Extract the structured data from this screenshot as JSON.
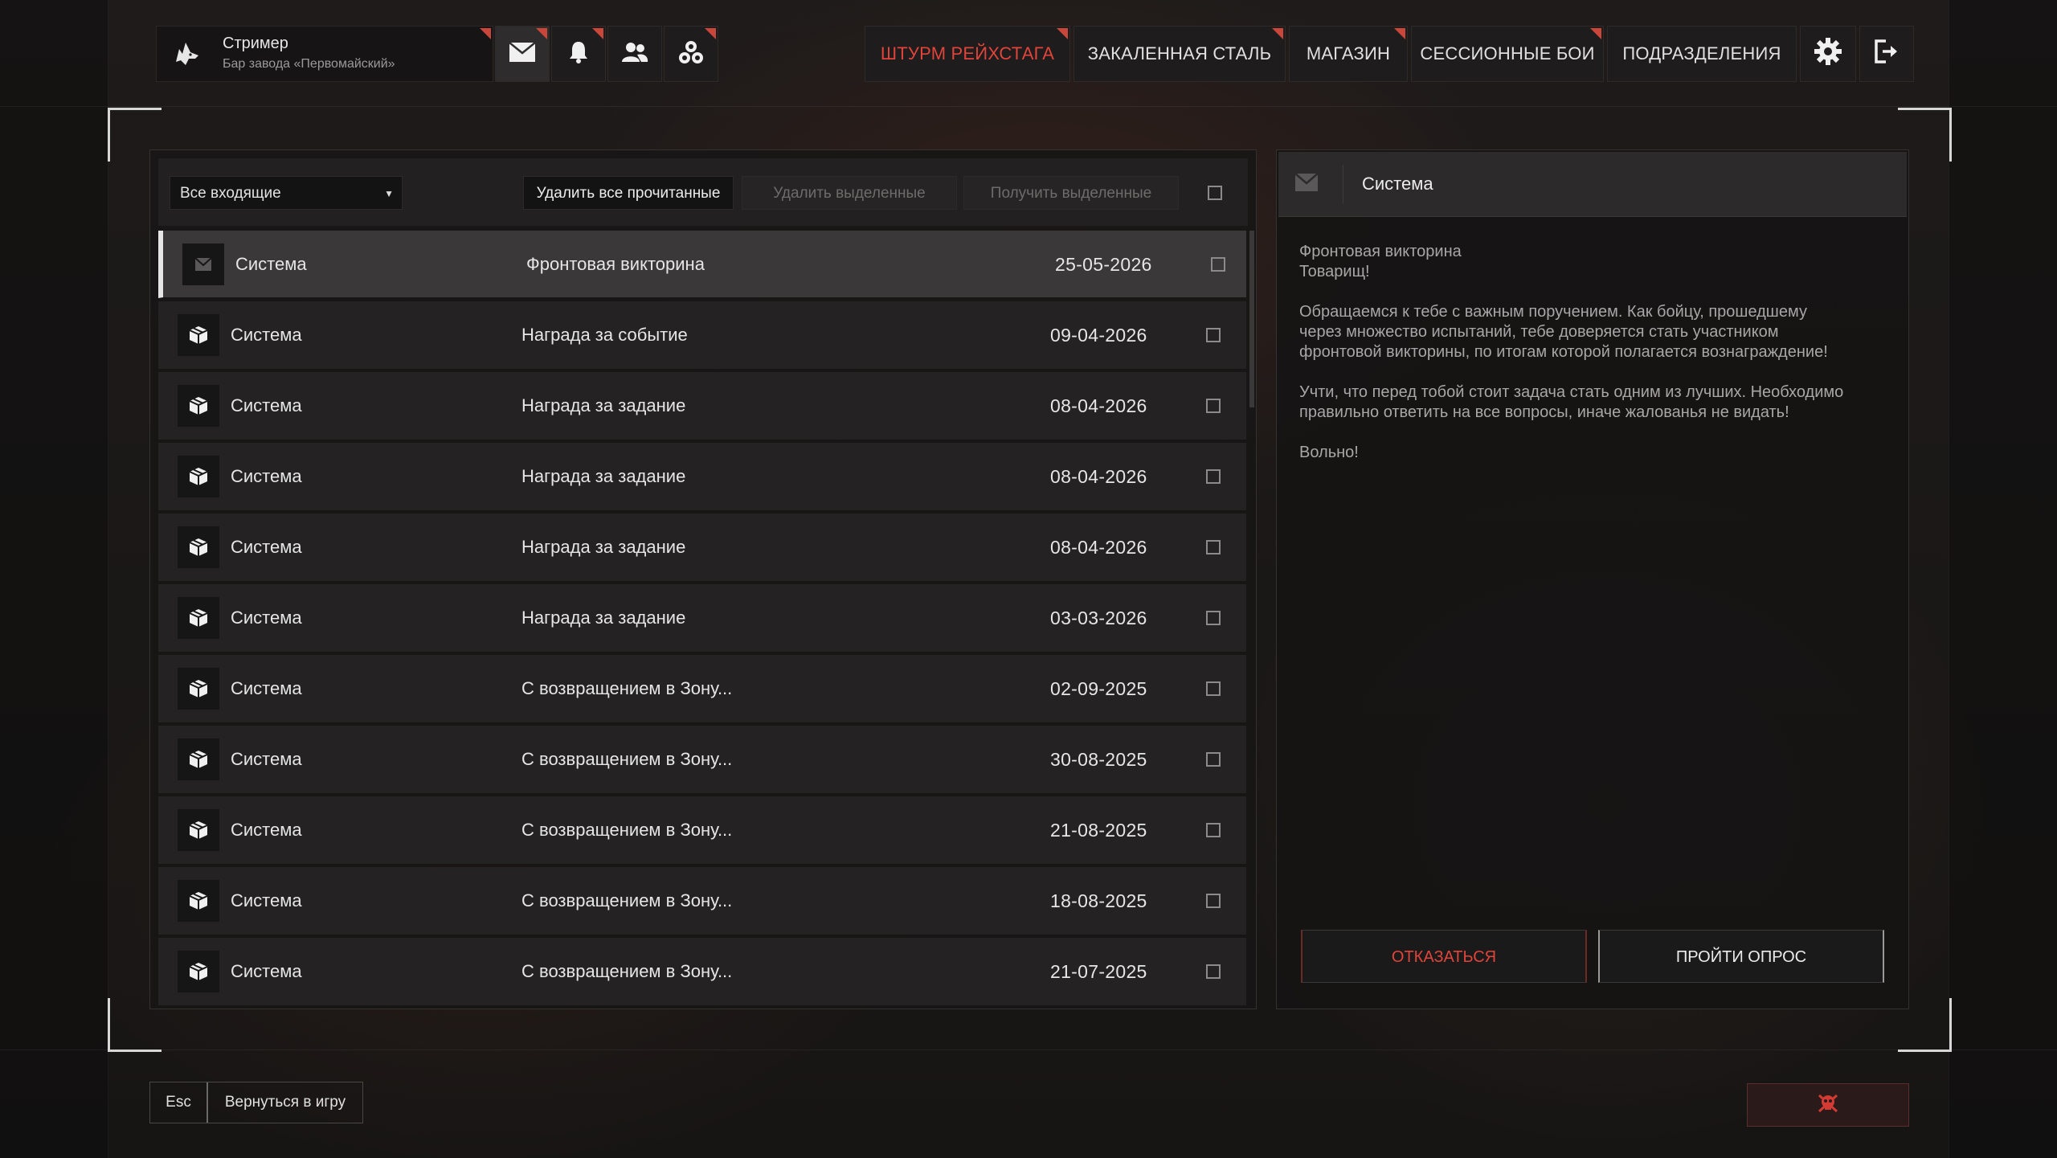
{
  "profile": {
    "name": "Стример",
    "subtitle": "Бар завода «Первомайский»",
    "avatar_icon": "wolf-icon"
  },
  "top_icons": [
    "mail-icon",
    "bell-icon",
    "friends-icon",
    "squads-icon"
  ],
  "nav": {
    "items": [
      "ШТУРМ РЕЙХСТАГА",
      "ЗАКАЛЕННАЯ СТАЛЬ",
      "МАГАЗИН",
      "СЕССИОННЫЕ БОИ",
      "ПОДРАЗДЕЛЕНИЯ"
    ],
    "active_color": "#e0443a"
  },
  "toolbar": {
    "filter_value": "Все входящие",
    "delete_read": "Удалить все прочитанные",
    "delete_selected": "Удалить выделенные",
    "get_selected": "Получить выделенные"
  },
  "messages": [
    {
      "sender": "Система",
      "subject": "Фронтовая викторина",
      "date": "25-05-2026",
      "icon": "envelope-icon"
    },
    {
      "sender": "Система",
      "subject": "Награда за событие",
      "date": "09-04-2026",
      "icon": "box-icon"
    },
    {
      "sender": "Система",
      "subject": "Награда за задание",
      "date": "08-04-2026",
      "icon": "box-icon"
    },
    {
      "sender": "Система",
      "subject": "Награда за задание",
      "date": "08-04-2026",
      "icon": "box-icon"
    },
    {
      "sender": "Система",
      "subject": "Награда за задание",
      "date": "08-04-2026",
      "icon": "box-icon"
    },
    {
      "sender": "Система",
      "subject": "Награда за задание",
      "date": "03-03-2026",
      "icon": "box-icon"
    },
    {
      "sender": "Система",
      "subject": "С возвращением в Зону...",
      "date": "02-09-2025",
      "icon": "box-icon"
    },
    {
      "sender": "Система",
      "subject": "С возвращением в Зону...",
      "date": "30-08-2025",
      "icon": "box-icon"
    },
    {
      "sender": "Система",
      "subject": "С возвращением в Зону...",
      "date": "21-08-2025",
      "icon": "box-icon"
    },
    {
      "sender": "Система",
      "subject": "С возвращением в Зону...",
      "date": "18-08-2025",
      "icon": "box-icon"
    },
    {
      "sender": "Система",
      "subject": "С возвращением в Зону...",
      "date": "21-07-2025",
      "icon": "box-icon"
    }
  ],
  "detail": {
    "sender": "Система",
    "title": "Фронтовая викторина\nТоварищ!",
    "p1": "Обращаемся к тебе с важным поручением. Как бойцу, прошедшему\nчерез множество испытаний, тебе доверяется стать участником\nфронтовой викторины, по итогам которой полагается вознаграждение!",
    "p2": "Учти, что перед тобой стоит задача стать одним из лучших. Необходимо\nправильно ответить на все вопросы, иначе жалованья не видать!",
    "p3": "Вольно!",
    "decline": "ОТКАЗАТЬСЯ",
    "accept": "ПРОЙТИ ОПРОС"
  },
  "footer": {
    "key": "Esc",
    "back": "Вернуться в игру",
    "danger_icon": "skull-crossbones-icon"
  }
}
